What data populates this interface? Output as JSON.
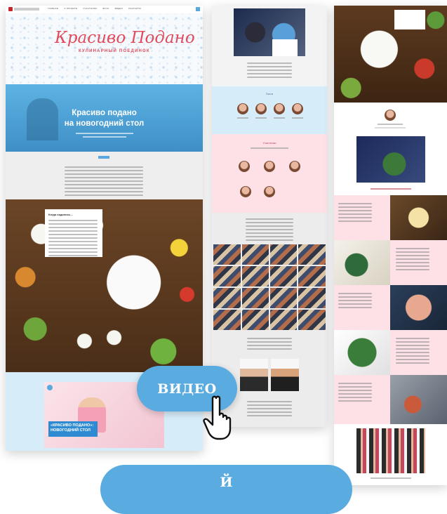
{
  "header": {
    "logo_script": "Красиво Подано",
    "logo_sub": "КУЛИНАРНЫЙ ПОЕДИНОК",
    "nav": [
      "ГЛАВНАЯ",
      "О ПРОЕКТЕ",
      "УЧАСТНИКИ",
      "ФОТО",
      "ВИДЕО",
      "КОНТАКТЫ"
    ]
  },
  "hero": {
    "title_line1": "Красиво подано",
    "title_line2": "на новогодний стол"
  },
  "intro_card": {
    "heading": "Когда садились..."
  },
  "video_preview": {
    "banner_line1": "«КРАСИВО ПОДАНО»:",
    "banner_line2": "НОВОГОДНИЙ СТОЛ"
  },
  "cta": {
    "video_button": "ВИДЕО",
    "bottom_button": "Й"
  },
  "mid_column": {
    "guests_heading": "Гости",
    "participants_heading": "Участники"
  },
  "colors": {
    "hero_blue": "#5aa9dd",
    "light_blue": "#d6ecf8",
    "pink": "#fde1e6",
    "button_blue": "#5aabe0"
  },
  "icons": {
    "pointer": "hand-pointer-icon"
  }
}
